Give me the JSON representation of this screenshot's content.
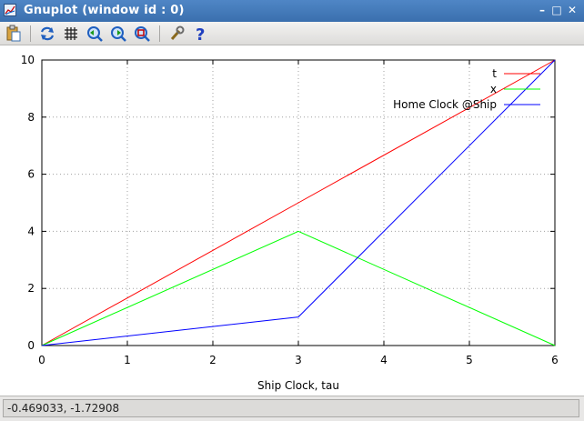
{
  "window": {
    "title": "Gnuplot (window id : 0)"
  },
  "titlebar_buttons": {
    "minimize": "–",
    "maximize": "□",
    "close": "✕"
  },
  "toolbar": {
    "buttons": [
      {
        "icon": "clipboard-icon"
      },
      {
        "icon": "replot-icon"
      },
      {
        "icon": "grid-icon"
      },
      {
        "icon": "zoom-previous-icon"
      },
      {
        "icon": "zoom-next-icon"
      },
      {
        "icon": "autoscale-icon"
      },
      {
        "icon": "settings-wrench-icon"
      },
      {
        "icon": "help-icon"
      }
    ]
  },
  "status": {
    "coordinates": "-0.469033, -1.72908"
  },
  "chart_data": {
    "type": "line",
    "xlabel": "Ship Clock, tau",
    "ylabel": "",
    "xlim": [
      0,
      6
    ],
    "ylim": [
      0,
      10
    ],
    "xticks": [
      0,
      1,
      2,
      3,
      4,
      5,
      6
    ],
    "yticks": [
      0,
      2,
      4,
      6,
      8,
      10
    ],
    "grid": true,
    "legend_position": "top-right",
    "series": [
      {
        "name": "t",
        "color": "#ff0000",
        "x": [
          0,
          3,
          6
        ],
        "y": [
          0,
          5,
          10
        ]
      },
      {
        "name": "x",
        "color": "#00ff00",
        "x": [
          0,
          3,
          6
        ],
        "y": [
          0,
          4,
          0
        ]
      },
      {
        "name": "Home Clock @Ship",
        "color": "#0000ff",
        "x": [
          0,
          3,
          6
        ],
        "y": [
          0,
          1,
          10
        ]
      }
    ]
  }
}
